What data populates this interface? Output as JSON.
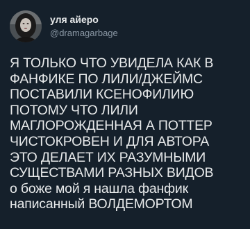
{
  "tweet": {
    "display_name": "уля айеро",
    "handle": "@dramagarbage",
    "avatar_icon": "profile-photo",
    "text_lines": [
      "Я ТОЛЬКО ЧТО УВИДЕЛА КАК В",
      "ФАНФИКЕ ПО ЛИЛИ/ДЖЕЙМС",
      "ПОСТАВИЛИ КСЕНОФИЛИЮ",
      "ПОТОМУ ЧТО ЛИЛИ",
      "МАГЛОРОЖДЕННАЯ А ПОТТЕР",
      "ЧИСТОКРОВЕН И ДЛЯ АВТОРА",
      "ЭТО ДЕЛАЕТ ИХ РАЗУМНЫМИ",
      "СУЩЕСТВАМИ РАЗНЫХ ВИДОВ",
      "о боже мой я нашла фанфик",
      "написанный ВОЛДЕМОРТОМ"
    ]
  },
  "colors": {
    "background": "#15202b",
    "text": "#e7e9ea",
    "secondary_text": "#8b98a5"
  }
}
